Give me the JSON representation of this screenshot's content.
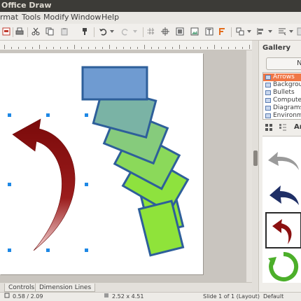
{
  "window": {
    "title": "Office Draw"
  },
  "menu": [
    "rmat",
    "Tools",
    "Modify",
    "Window",
    "Help"
  ],
  "toolbar": {
    "icons": [
      "pdf-export-icon",
      "print-icon",
      "cut-icon",
      "copy-icon",
      "paste-icon",
      "clone-format-icon",
      "undo-icon",
      "redo-icon",
      "grid-icon",
      "helplines-icon",
      "image-icon",
      "insert-image-icon",
      "textbox-icon",
      "fontwork-icon",
      "shapes-icon",
      "align-icon",
      "arrange-icon",
      "more-icon"
    ]
  },
  "drawing": {
    "colors": {
      "arrow": "#8b1010",
      "rect_top": "#6f9bd1",
      "rect_bottom": "#8fe33a",
      "rect_border": "#2e5f9a",
      "handle": "#1e88e5"
    }
  },
  "bottom_tabs": [
    "Controls",
    "Dimension Lines"
  ],
  "status": {
    "position": "0.58 / 2.09",
    "size": "2.52 x 4.51",
    "slide": "Slide 1 of 1 (Layout)",
    "style": "Default"
  },
  "gallery": {
    "title": "Gallery",
    "new_button": "N",
    "themes": [
      {
        "label": "Arrows",
        "selected": true
      },
      {
        "label": "Backgrou",
        "selected": false
      },
      {
        "label": "Bullets",
        "selected": false
      },
      {
        "label": "Computer",
        "selected": false
      },
      {
        "label": "Diagrams",
        "selected": false
      },
      {
        "label": "Environm",
        "selected": false
      }
    ],
    "view_label": "Ar",
    "thumbs": [
      "gray-arrow-icon",
      "navy-arrow-icon",
      "red-arrow-icon",
      "green-circular-arrow-icon"
    ]
  }
}
